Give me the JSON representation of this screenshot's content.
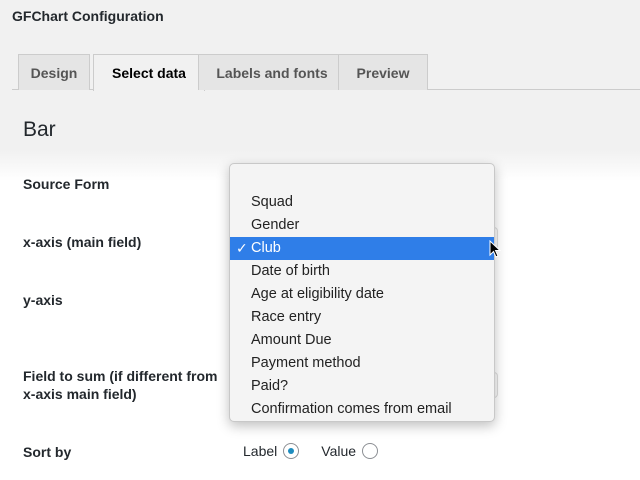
{
  "window": {
    "title": "GFChart Configuration"
  },
  "tabs": [
    {
      "label": "Design",
      "active": false
    },
    {
      "label": "Select data",
      "active": true
    },
    {
      "label": "Labels and fonts",
      "active": false
    },
    {
      "label": "Preview",
      "active": false
    }
  ],
  "section": {
    "title": "Bar"
  },
  "form": {
    "source_form_label": "Source Form",
    "xaxis_label": "x-axis (main field)",
    "yaxis_label": "y-axis",
    "field_to_sum_label_line1": "Field to sum (if different from",
    "field_to_sum_label_line2": "x-axis main field)",
    "sort_by_label": "Sort by",
    "sort_options": [
      {
        "label": "Label",
        "checked": true
      },
      {
        "label": "Value",
        "checked": false
      }
    ]
  },
  "dropdown": {
    "options": [
      "Squad",
      "Gender",
      "Club",
      "Date of birth",
      "Age at eligibility date",
      "Race entry",
      "Amount Due",
      "Payment method",
      "Paid?",
      "Confirmation comes from email"
    ],
    "selected": "Club",
    "check_glyph": "✓"
  },
  "colors": {
    "selection": "#2f7ee8",
    "radio_accent": "#1e8cbe"
  }
}
